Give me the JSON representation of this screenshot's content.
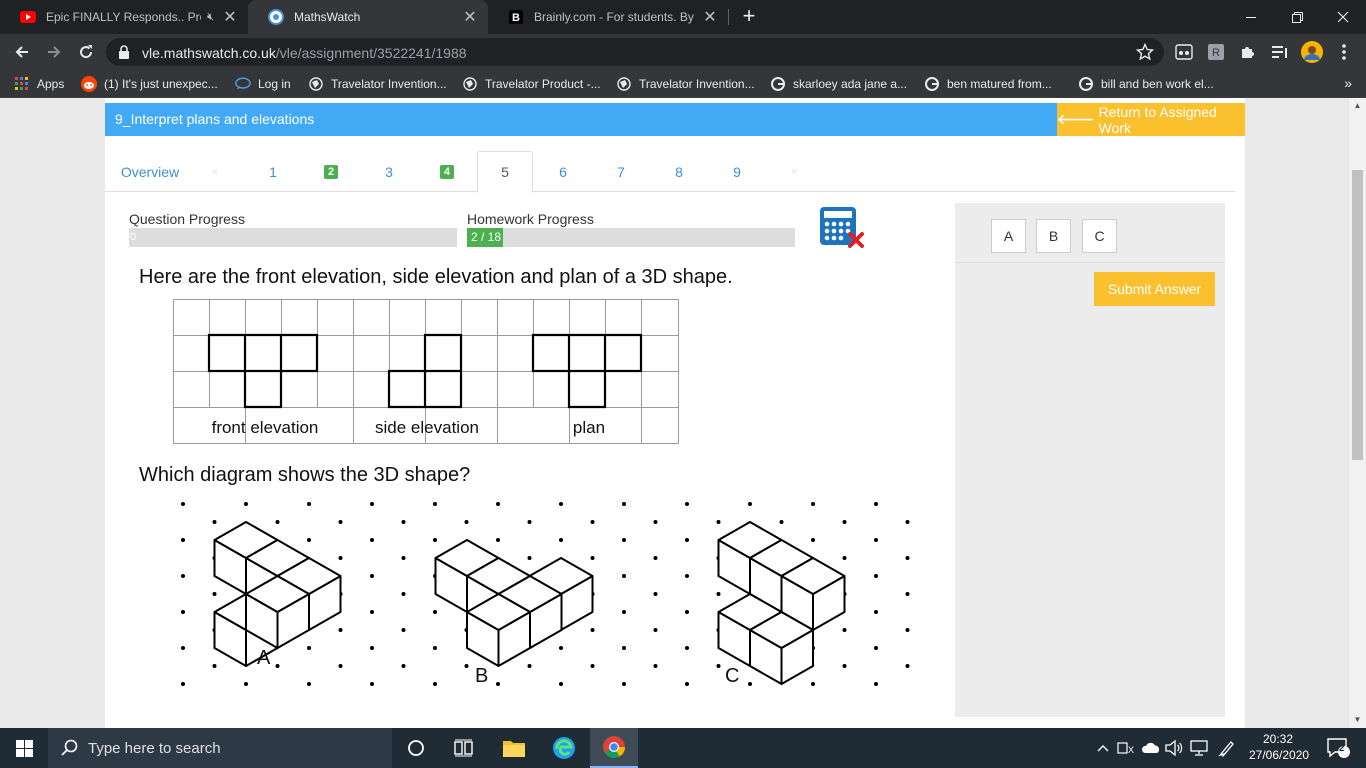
{
  "browser": {
    "tabs": [
      {
        "title": "Epic FINALLY Responds.. Pro",
        "favicon": "youtube-icon",
        "muted": true
      },
      {
        "title": "MathsWatch",
        "favicon": "mathswatch-icon",
        "active": true
      },
      {
        "title": "Brainly.com - For students. By stu",
        "favicon": "brainly-icon"
      }
    ],
    "url_host": "vle.mathswatch.co.uk",
    "url_path": "/vle/assignment/3522241/1988",
    "bookmarks": [
      {
        "label": "Apps",
        "icon": "apps-grid-icon"
      },
      {
        "label": "(1) It's just unexpec...",
        "icon": "reddit-icon"
      },
      {
        "label": "Log in",
        "icon": "chat-bubble-icon"
      },
      {
        "label": "Travelator Invention...",
        "icon": "globe-icon"
      },
      {
        "label": "Travelator Product -...",
        "icon": "globe-icon"
      },
      {
        "label": "Travelator Invention...",
        "icon": "globe-icon"
      },
      {
        "label": "skarloey ada jane a...",
        "icon": "google-icon"
      },
      {
        "label": "ben matured from...",
        "icon": "google-icon"
      },
      {
        "label": "bill and ben work el...",
        "icon": "google-icon"
      }
    ],
    "bookmarks_more": "»"
  },
  "header": {
    "title": "9_Interpret plans and elevations",
    "return_label": "Return to Assigned Work"
  },
  "qnav": {
    "overview": "Overview",
    "prev": "«",
    "next": "»",
    "items": [
      {
        "label": "1",
        "answered": false
      },
      {
        "label": "2",
        "answered": true
      },
      {
        "label": "3",
        "answered": false
      },
      {
        "label": "4",
        "answered": true
      },
      {
        "label": "5",
        "answered": false,
        "active": true
      },
      {
        "label": "6",
        "answered": false
      },
      {
        "label": "7",
        "answered": false
      },
      {
        "label": "8",
        "answered": false
      },
      {
        "label": "9",
        "answered": false
      }
    ]
  },
  "progress": {
    "question_label": "Question Progress",
    "question_text": "0",
    "question_fraction": 0,
    "homework_label": "Homework Progress",
    "homework_text": "2 / 18",
    "homework_fraction": 0.111
  },
  "question": {
    "prompt": "Here are the front elevation, side elevation and plan of a 3D shape.",
    "labels": {
      "front": "front elevation",
      "side": "side elevation",
      "plan": "plan"
    },
    "ask": "Which diagram shows the 3D shape?",
    "options": [
      "A",
      "B",
      "C"
    ]
  },
  "answer_panel": {
    "choices": [
      "A",
      "B",
      "C"
    ],
    "submit_label": "Submit Answer"
  },
  "taskbar": {
    "search_placeholder": "Type here to search",
    "time": "20:32",
    "date": "27/06/2020",
    "notifications": "2"
  },
  "colors": {
    "header_blue": "#42a9f4",
    "accent_yellow": "#fbc02d",
    "success_green": "#4caf50",
    "link_blue": "#3d8fd6"
  }
}
